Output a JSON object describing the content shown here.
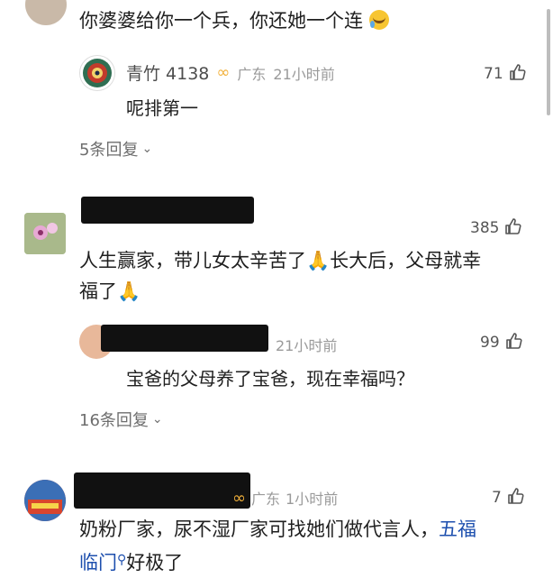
{
  "comment1": {
    "text": "你婆婆给你一个兵，你还她一个连",
    "emoji": "laughing-crying",
    "reply": {
      "username": "青竹 4138",
      "location": "广东",
      "time": "21小时前",
      "likes": "71",
      "text": "呢排第一"
    },
    "replies_label": "5条回复"
  },
  "comment2": {
    "likes": "385",
    "text_line1": "人生赢家，带儿女太辛苦了",
    "text_mid": "长大后，父母就幸",
    "text_line2": "福了",
    "reply": {
      "time": "21小时前",
      "likes": "99",
      "text": "宝爸的父母养了宝爸，现在幸福吗？"
    },
    "replies_label": "16条回复"
  },
  "comment3": {
    "location": "广东",
    "time": "1小时前",
    "likes": "7",
    "text_a": "奶粉厂家，尿不湿厂家可找她们做代言人，",
    "topic_a": "五福",
    "topic_b": "临门",
    "text_b": "好极了"
  },
  "colors": {
    "topic_link": "#1d4fae",
    "meta_gray": "#9a9a9a",
    "redaction": "#111111"
  }
}
